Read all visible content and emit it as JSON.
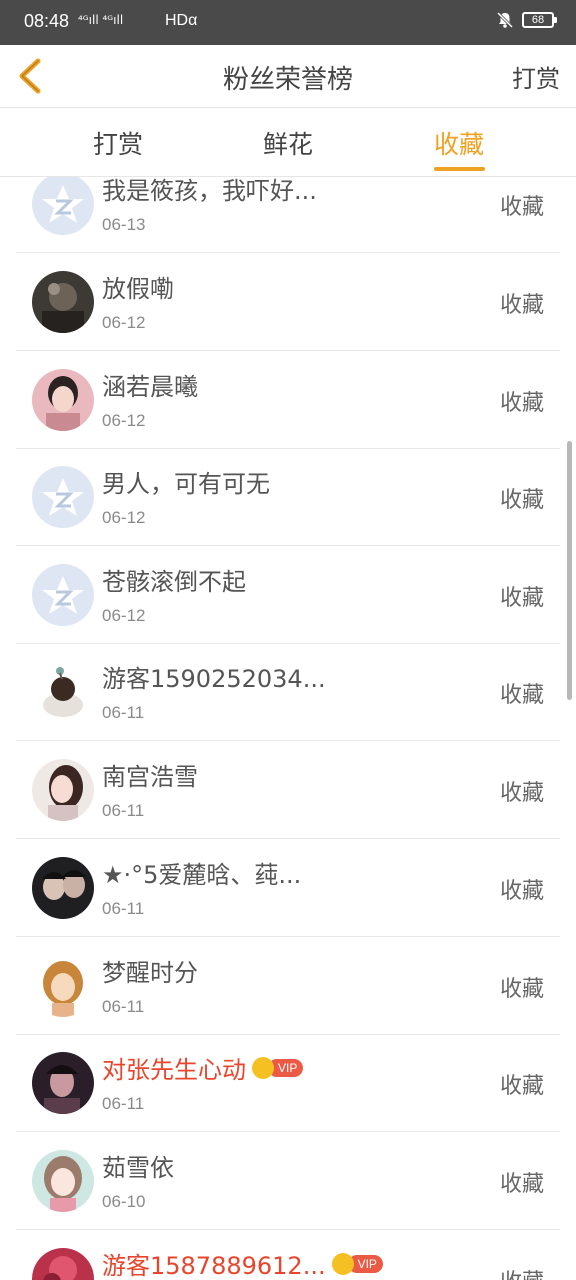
{
  "status_bar": {
    "time": "08:48",
    "signal": "⁴ᴳıll ⁴ᴳıll",
    "network": "HDα",
    "battery": "68"
  },
  "header": {
    "title": "粉丝荣誉榜",
    "action": "打赏"
  },
  "tabs": [
    {
      "label": "打赏",
      "active": false
    },
    {
      "label": "鲜花",
      "active": false
    },
    {
      "label": "收藏",
      "active": true
    }
  ],
  "colors": {
    "accent": "#f0a121",
    "vip_name": "#e8452c"
  },
  "list": [
    {
      "name": "我是筱孩，我吓好...",
      "date": "06-13",
      "action": "收藏",
      "avatar": "default-q-icon",
      "vip": false
    },
    {
      "name": "放假嘞",
      "date": "06-12",
      "action": "收藏",
      "avatar": "user-photo",
      "vip": false
    },
    {
      "name": "涵若晨曦",
      "date": "06-12",
      "action": "收藏",
      "avatar": "user-photo",
      "vip": false
    },
    {
      "name": "男人，可有可无",
      "date": "06-12",
      "action": "收藏",
      "avatar": "default-q-icon",
      "vip": false
    },
    {
      "name": "苍骸滚倒不起",
      "date": "06-12",
      "action": "收藏",
      "avatar": "default-q-icon",
      "vip": false
    },
    {
      "name": "游客1590252034...",
      "date": "06-11",
      "action": "收藏",
      "avatar": "user-photo",
      "vip": false
    },
    {
      "name": "南宫浩雪",
      "date": "06-11",
      "action": "收藏",
      "avatar": "user-photo",
      "vip": false
    },
    {
      "name": "★·°5爱麓晗、莼...",
      "date": "06-11",
      "action": "收藏",
      "avatar": "user-photo",
      "vip": false
    },
    {
      "name": "梦醒时分",
      "date": "06-11",
      "action": "收藏",
      "avatar": "user-photo",
      "vip": false
    },
    {
      "name": "对张先生心动",
      "date": "06-11",
      "action": "收藏",
      "avatar": "user-photo",
      "vip": true,
      "vip_label": "VIP"
    },
    {
      "name": "茹雪依",
      "date": "06-10",
      "action": "收藏",
      "avatar": "user-photo",
      "vip": false
    },
    {
      "name": "游客1587889612...",
      "date": "",
      "action": "收藏",
      "avatar": "user-photo",
      "vip": true,
      "vip_label": "VIP"
    }
  ]
}
